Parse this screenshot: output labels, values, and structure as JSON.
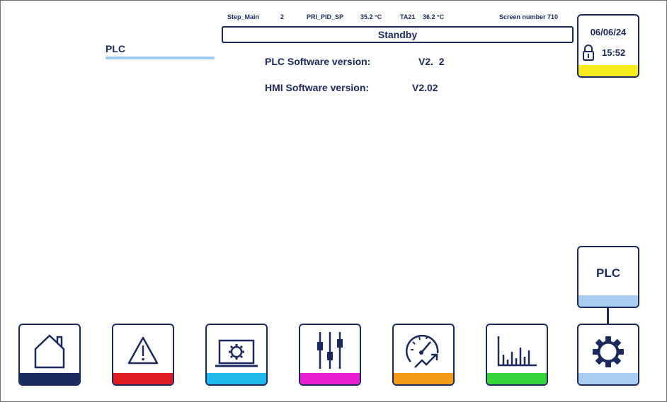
{
  "header": {
    "step_label": "Step_Main",
    "step_value": "2",
    "pid_label": "PRI_PID_SP",
    "pid_value": "35.2 °C",
    "ta_label": "TA21",
    "ta_value": "36.2 °C",
    "screen_label": "Screen number 710",
    "status": "Standby"
  },
  "clock": {
    "date": "06/06/24",
    "time": "15:52",
    "strip_color": "#f6ec1c"
  },
  "page": {
    "title": "PLC",
    "plc_sw_label": "PLC Software version:",
    "plc_sw_value": "V2.  2",
    "hmi_sw_label": "HMI Software version:",
    "hmi_sw_value": "V2.02"
  },
  "submenu": {
    "plc_button": "PLC",
    "bar_color": "#a9cdee"
  },
  "nav": [
    {
      "name": "home",
      "icon": "home-icon",
      "color": "#1a2a5e"
    },
    {
      "name": "alarms",
      "icon": "warning-icon",
      "color": "#e11b22"
    },
    {
      "name": "machine",
      "icon": "laptop-gear-icon",
      "color": "#1fb8ea"
    },
    {
      "name": "settings",
      "icon": "sliders-icon",
      "color": "#e81ed0"
    },
    {
      "name": "performance",
      "icon": "gauge-trend-icon",
      "color": "#f39a17"
    },
    {
      "name": "statistics",
      "icon": "bar-chart-icon",
      "color": "#34d63a"
    },
    {
      "name": "system",
      "icon": "gear-icon",
      "color": "#a9cdee"
    }
  ]
}
